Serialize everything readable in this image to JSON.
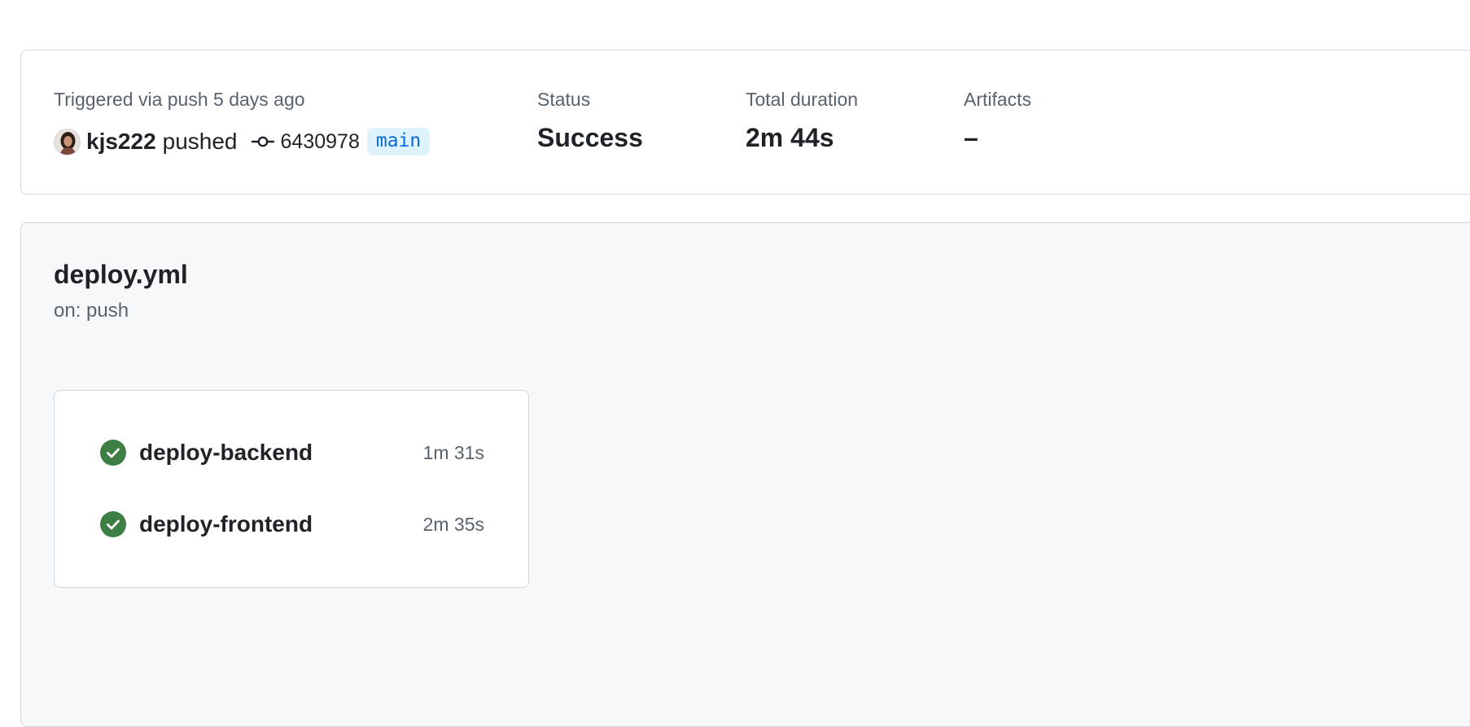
{
  "run_summary": {
    "trigger_text": "Triggered via push 5 days ago",
    "actor": "kjs222",
    "action": "pushed",
    "commit_sha": "6430978",
    "branch": "main",
    "status_label": "Status",
    "status_value": "Success",
    "duration_label": "Total duration",
    "duration_value": "2m 44s",
    "artifacts_label": "Artifacts",
    "artifacts_value": "–"
  },
  "workflow": {
    "file_name": "deploy.yml",
    "trigger": "on: push",
    "jobs": [
      {
        "name": "deploy-backend",
        "duration": "1m 31s",
        "status": "success"
      },
      {
        "name": "deploy-frontend",
        "duration": "2m 35s",
        "status": "success"
      }
    ]
  },
  "colors": {
    "success": "#3c7e43",
    "branch_text": "#0969da",
    "branch_bg": "#ddf4ff",
    "muted_text": "#59636e",
    "border": "#d0d7de",
    "panel_bg": "#f6f8fa"
  },
  "icons": {
    "avatar": "user-avatar",
    "commit": "git-commit-icon",
    "job_status": "check-circle-fill-icon"
  }
}
